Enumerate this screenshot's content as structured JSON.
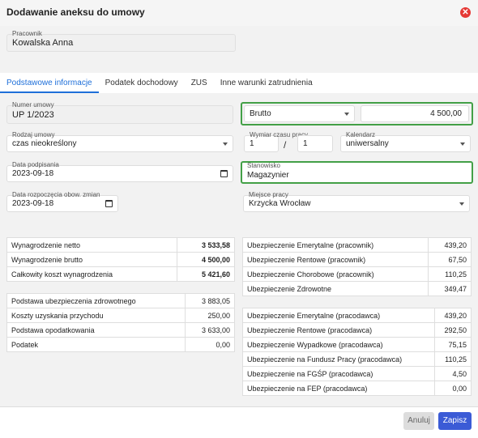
{
  "dialog": {
    "title": "Dodawanie aneksu do umowy"
  },
  "employee": {
    "label": "Pracownik",
    "value": "Kowalska Anna"
  },
  "tabs": [
    {
      "label": "Podstawowe informacje",
      "active": true
    },
    {
      "label": "Podatek dochodowy",
      "active": false
    },
    {
      "label": "ZUS",
      "active": false
    },
    {
      "label": "Inne warunki zatrudnienia",
      "active": false
    }
  ],
  "form": {
    "contract_no": {
      "label": "Numer umowy",
      "value": "UP 1/2023"
    },
    "salary_type": {
      "value": "Brutto"
    },
    "salary_amount": {
      "value": "4 500,00"
    },
    "contract_kind": {
      "label": "Rodzaj umowy",
      "value": "czas nieokreślony"
    },
    "work_time": {
      "label": "Wymiar czasu pracy",
      "numerator": "1",
      "separator": "/",
      "denominator": "1"
    },
    "calendar": {
      "label": "Kalendarz",
      "value": "uniwersalny"
    },
    "sign_date": {
      "label": "Data podpisania",
      "value": "2023-09-18"
    },
    "position": {
      "label": "Stanowisko",
      "value": "Magazynier"
    },
    "start_date": {
      "label": "Data rozpoczęcia obow. zmian",
      "value": "2023-09-18"
    },
    "workplace": {
      "label": "Miejsce pracy",
      "value": "Krzycka Wrocław"
    }
  },
  "summary_left_top": [
    {
      "label": "Wynagrodzenie netto",
      "value": "3 533,58"
    },
    {
      "label": "Wynagrodzenie brutto",
      "value": "4 500,00"
    },
    {
      "label": "Całkowity koszt wynagrodzenia",
      "value": "5 421,60"
    }
  ],
  "summary_left_bottom": [
    {
      "label": "Podstawa ubezpieczenia zdrowotnego",
      "value": "3 883,05"
    },
    {
      "label": "Koszty uzyskania przychodu",
      "value": "250,00"
    },
    {
      "label": "Podstawa opodatkowania",
      "value": "3 633,00"
    },
    {
      "label": "Podatek",
      "value": "0,00"
    }
  ],
  "summary_right_top": [
    {
      "label": "Ubezpieczenie Emerytalne (pracownik)",
      "value": "439,20"
    },
    {
      "label": "Ubezpieczenie Rentowe (pracownik)",
      "value": "67,50"
    },
    {
      "label": "Ubezpieczenie Chorobowe (pracownik)",
      "value": "110,25"
    },
    {
      "label": "Ubezpieczenie Zdrowotne",
      "value": "349,47"
    }
  ],
  "summary_right_bottom": [
    {
      "label": "Ubezpieczenie Emerytalne (pracodawca)",
      "value": "439,20"
    },
    {
      "label": "Ubezpieczenie Rentowe (pracodawca)",
      "value": "292,50"
    },
    {
      "label": "Ubezpieczenie Wypadkowe (pracodawca)",
      "value": "75,15"
    },
    {
      "label": "Ubezpieczenie na Fundusz Pracy (pracodawca)",
      "value": "110,25"
    },
    {
      "label": "Ubezpieczenie na FGŚP (pracodawca)",
      "value": "4,50"
    },
    {
      "label": "Ubezpieczenie na FEP (pracodawca)",
      "value": "0,00"
    }
  ],
  "footer": {
    "cancel_label": "Anuluj",
    "save_label": "Zapisz"
  },
  "colors": {
    "accent": "#1e6fd9",
    "highlight": "#43a047",
    "close": "#e53935",
    "save": "#3b5bd6"
  }
}
